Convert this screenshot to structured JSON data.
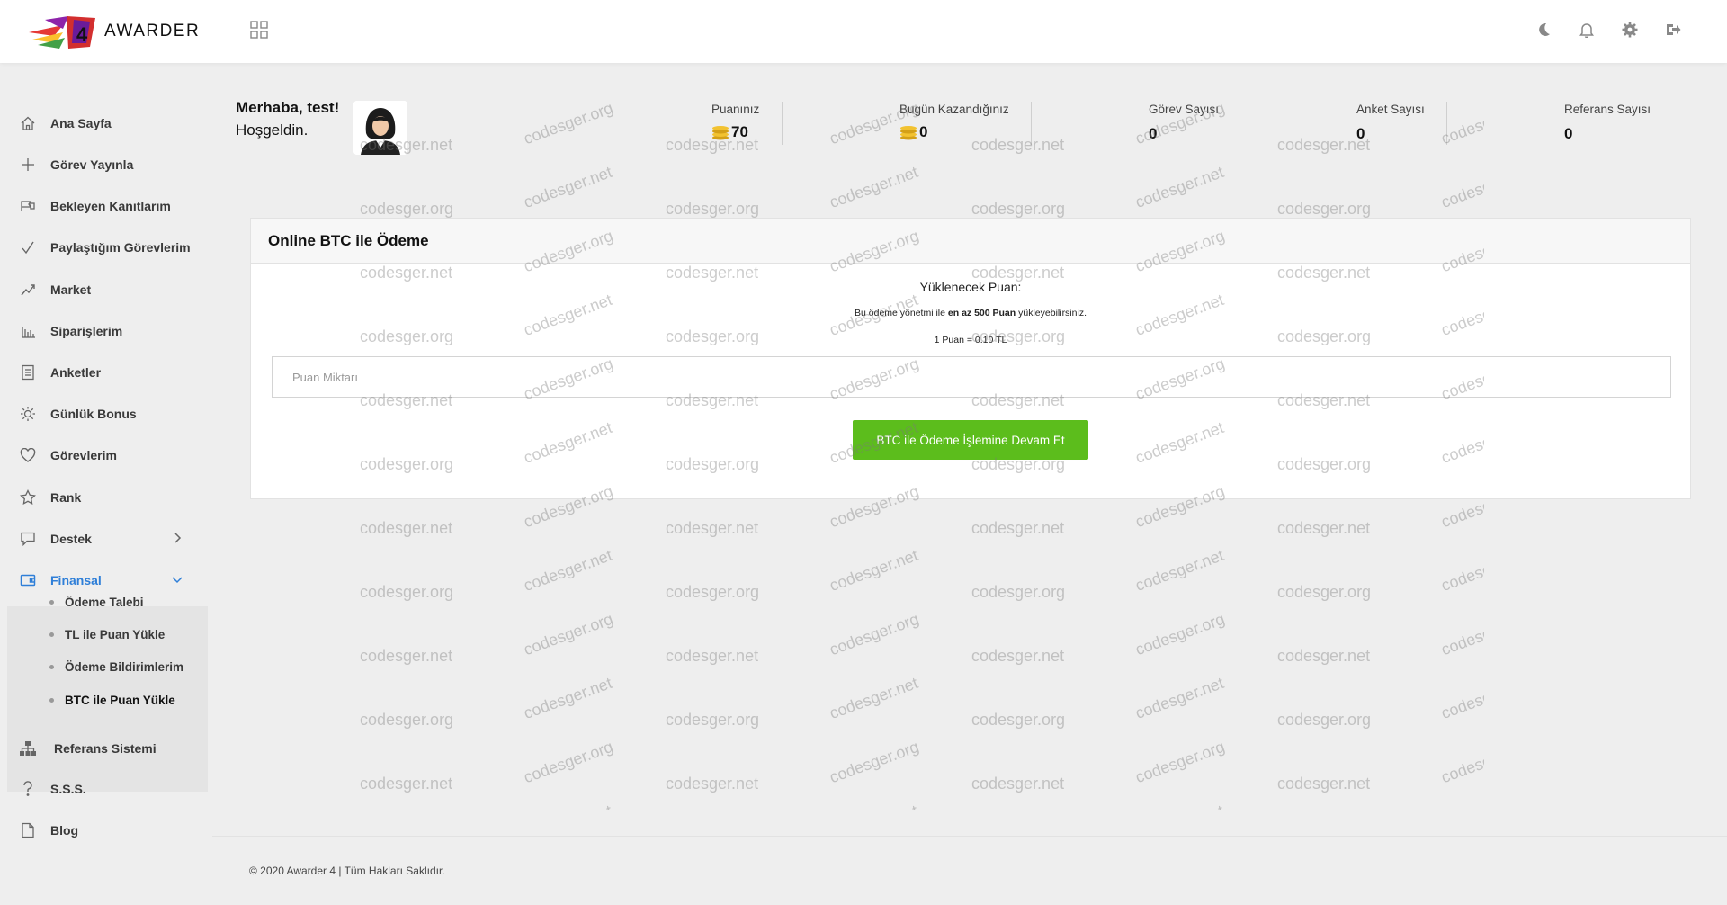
{
  "brand": {
    "name": "AWARDER"
  },
  "header": {
    "icons": [
      "moon-icon",
      "bell-icon",
      "gear-icon",
      "logout-icon"
    ]
  },
  "sidebar": {
    "items": [
      {
        "label": "Ana Sayfa",
        "icon": "home-icon"
      },
      {
        "label": "Görev Yayınla",
        "icon": "plus-icon"
      },
      {
        "label": "Bekleyen Kanıtlarım",
        "icon": "flag-icon"
      },
      {
        "label": "Paylaştığım Görevlerim",
        "icon": "check-icon"
      },
      {
        "label": "Market",
        "icon": "market-icon"
      },
      {
        "label": "Siparişlerim",
        "icon": "chart-icon"
      },
      {
        "label": "Anketler",
        "icon": "list-icon"
      },
      {
        "label": "Günlük Bonus",
        "icon": "sun-icon"
      },
      {
        "label": "Görevlerim",
        "icon": "heart-icon"
      },
      {
        "label": "Rank",
        "icon": "star-icon"
      },
      {
        "label": "Destek",
        "icon": "chat-icon"
      },
      {
        "label": "Finansal",
        "icon": "wallet-icon"
      },
      {
        "label": "Referans Sistemi",
        "icon": "sitemap-icon"
      },
      {
        "label": "S.S.S.",
        "icon": "question-icon"
      },
      {
        "label": "Blog",
        "icon": "file-icon"
      }
    ],
    "finance_sub": [
      {
        "label": "Ödeme Talebi"
      },
      {
        "label": "TL ile Puan Yükle"
      },
      {
        "label": "Ödeme Bildirimlerim"
      },
      {
        "label": "BTC ile Puan Yükle"
      }
    ],
    "active_color": "#2f7fd8"
  },
  "welcome": {
    "line1": "Merhaba, test!",
    "line2": "Hoşgeldin."
  },
  "stats": [
    {
      "label": "Puanınız",
      "value": "70"
    },
    {
      "label": "Bugün Kazandığınız",
      "value": "0"
    },
    {
      "label": "Görev Sayısı",
      "value": "0"
    },
    {
      "label": "Anket Sayısı",
      "value": "0"
    },
    {
      "label": "Referans Sayısı",
      "value": "0"
    }
  ],
  "card": {
    "title": "Online BTC ile Ödeme",
    "load_title": "Yüklenecek Puan:",
    "info_prefix": "Bu ödeme yönetmi ile",
    "info_bold": "en az 500 Puan",
    "info_suffix": "yükleyebilirsiniz.",
    "rate": "1 Puan = 0.10 TL",
    "input_placeholder": "Puan Miktarı",
    "input_value": "",
    "button_label": "BTC ile Ödeme İşlemine Devam Et",
    "button_color": "#5cbd1c"
  },
  "watermark": {
    "a": "codesger.net",
    "b": "codesger.org"
  },
  "footer": {
    "text": "© 2020 Awarder 4 | Tüm Hakları Saklıdır."
  }
}
